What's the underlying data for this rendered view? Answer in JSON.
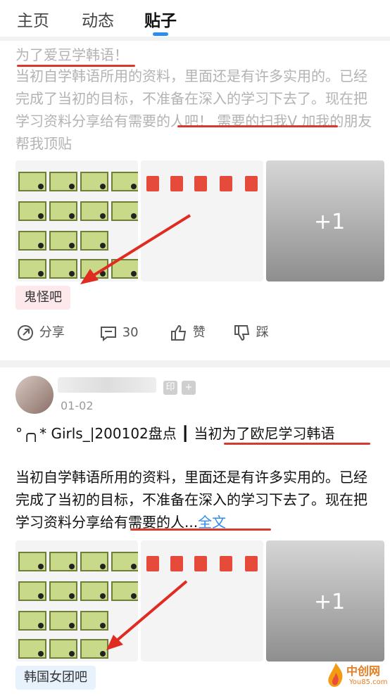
{
  "tabs": [
    "主页",
    "动态",
    "贴子"
  ],
  "post1": {
    "title": "为了爱豆学韩语！",
    "body": "当初自学韩语所用的资料，里面还是有许多实用的。已经完成了当初的目标，不准备在深入的学习下去了。现在把学习资料分享给有需要的人吧！ 需要的扫我V 加我的朋友帮我顶贴",
    "more_images": "+1",
    "tag": "鬼怪吧",
    "actions": {
      "share": "分享",
      "comments": "30",
      "like": "赞",
      "dislike": "踩"
    }
  },
  "post2": {
    "badge_print": "印",
    "badge_plus": "+",
    "date": "01-02",
    "title": "°╭╮* Girls_|200102盘点 ┃ 当初为了欧尼学习韩语",
    "body": "当初自学韩语所用的资料，里面还是有许多实用的。已经完成了当初的目标，不准备在深入的学习下去了。现在把学习资料分享给有需要的人...",
    "full_link": "全文",
    "more_images": "+1",
    "tag": "韩国女团吧"
  },
  "watermark": {
    "brand": "中创网",
    "url": "You85.com"
  },
  "colors": {
    "accent": "#2d8cf0",
    "underline_red": "#d63a2c",
    "tag1_bg": "#fde8ec",
    "tag2_bg": "#e8f2fd"
  }
}
